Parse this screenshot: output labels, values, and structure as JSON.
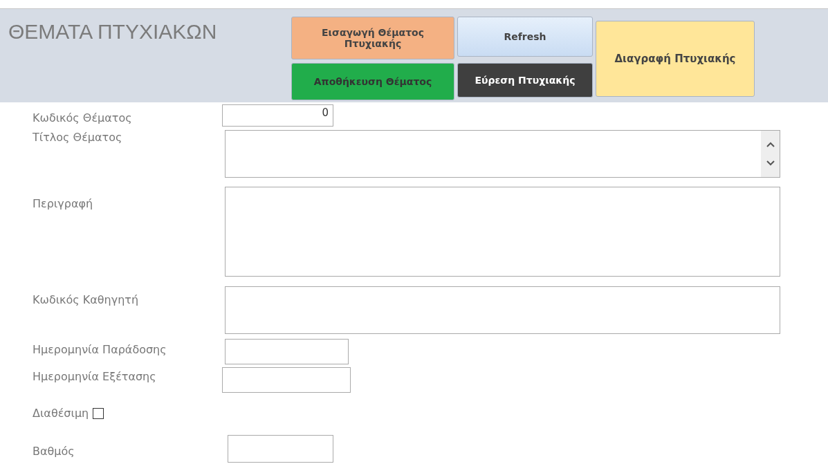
{
  "header": {
    "title": "ΘΕΜΑΤΑ ΠΤΥΧΙΑΚΩΝ",
    "buttons": [
      {
        "label": "Εισαγωγή Θέματος Πτυχιακής",
        "kind": "insert"
      },
      {
        "label": "Refresh",
        "kind": "refresh"
      },
      {
        "label": "Διαγραφή Πτυχιακής",
        "kind": "delete"
      },
      {
        "label": "Αποθήκευση Θέματος",
        "kind": "save"
      },
      {
        "label": "Εύρεση Πτυχιακής",
        "kind": "find"
      }
    ]
  },
  "form": {
    "fields": [
      {
        "label": "Κωδικός Θέματος",
        "kind": "number",
        "value": "0"
      },
      {
        "label": "Τίτλος Θέματος",
        "kind": "scroll"
      },
      {
        "label": "Περιγραφή",
        "kind": "tall"
      },
      {
        "label": "Κωδικός Καθηγητή",
        "kind": "wide"
      },
      {
        "label": "Ημερομηνία Παράδοσης",
        "kind": "date"
      },
      {
        "label": "Ημερομηνία Εξέτασης",
        "kind": "date2"
      },
      {
        "label": "Διαθέσιμη",
        "kind": "check",
        "checked": false
      },
      {
        "label": "Βαθμός",
        "kind": "grade"
      }
    ]
  }
}
